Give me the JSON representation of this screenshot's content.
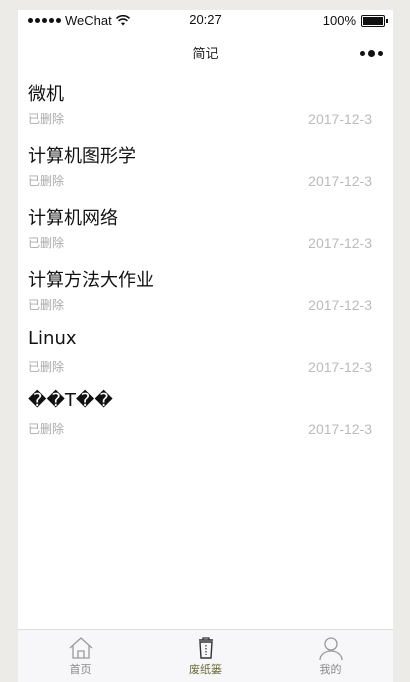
{
  "status_bar": {
    "carrier": "WeChat",
    "time": "20:27",
    "battery": "100%"
  },
  "nav": {
    "title": "简记"
  },
  "notes": [
    {
      "title": "微机",
      "status": "已删除",
      "date": "2017-12-3"
    },
    {
      "title": "计算机图形学",
      "status": "已删除",
      "date": "2017-12-3"
    },
    {
      "title": "计算机网络",
      "status": "已删除",
      "date": "2017-12-3"
    },
    {
      "title": "计算方法大作业",
      "status": "已删除",
      "date": "2017-12-3"
    },
    {
      "title": "Linux",
      "status": "已删除",
      "date": "2017-12-3"
    },
    {
      "title": "��T��",
      "status": "已删除",
      "date": "2017-12-3"
    }
  ],
  "tabbar": {
    "tabs": [
      {
        "label": "首页",
        "icon": "home-icon",
        "active": false
      },
      {
        "label": "废纸篓",
        "icon": "trash-icon",
        "active": true
      },
      {
        "label": "我的",
        "icon": "user-icon",
        "active": false
      }
    ],
    "active_color": "#6b6b3a",
    "inactive_color": "#999999"
  }
}
